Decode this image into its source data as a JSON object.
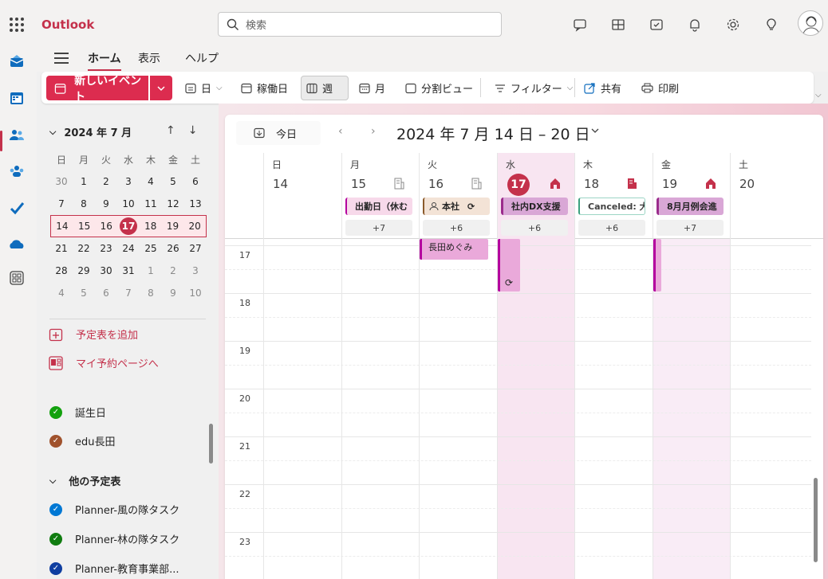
{
  "app": {
    "brand": "Outlook",
    "search_placeholder": "検索",
    "accent": "#c4314b"
  },
  "tabs": [
    {
      "label": "ホーム",
      "active": true
    },
    {
      "label": "表示",
      "active": false
    },
    {
      "label": "ヘルプ",
      "active": false
    }
  ],
  "ribbon": {
    "new_event": "新しいイベント",
    "day": "日",
    "workweek": "稼働日",
    "week": "週",
    "month": "月",
    "split": "分割ビュー",
    "filter": "フィルター",
    "share": "共有",
    "print": "印刷"
  },
  "mini_calendar": {
    "title": "2024 年 7 月",
    "weekdays": [
      "日",
      "月",
      "火",
      "水",
      "木",
      "金",
      "土"
    ],
    "weeks": [
      [
        "30",
        "1",
        "2",
        "3",
        "4",
        "5",
        "6"
      ],
      [
        "7",
        "8",
        "9",
        "10",
        "11",
        "12",
        "13"
      ],
      [
        "14",
        "15",
        "16",
        "17",
        "18",
        "19",
        "20"
      ],
      [
        "21",
        "22",
        "23",
        "24",
        "25",
        "26",
        "27"
      ],
      [
        "28",
        "29",
        "30",
        "31",
        "1",
        "2",
        "3"
      ],
      [
        "4",
        "5",
        "6",
        "7",
        "8",
        "9",
        "10"
      ]
    ],
    "today": "17"
  },
  "sidebar": {
    "add_calendar": "予定表を追加",
    "booking": "マイ予約ページへ",
    "calendars": [
      {
        "name": "誕生日",
        "color": "#13a10e"
      },
      {
        "name": "edu長田",
        "color": "#a0522d"
      }
    ],
    "other_group": "他の予定表",
    "other_calendars": [
      {
        "name": "Planner-風の隊タスク",
        "color": "#0078d4"
      },
      {
        "name": "Planner-林の隊タスク",
        "color": "#107c10"
      },
      {
        "name": "Planner-教育事業部...",
        "color": "#0f3ea0"
      }
    ]
  },
  "calendar": {
    "today_label": "今日",
    "range_title": "2024 年 7 月 14 日 – 20 日",
    "days": [
      {
        "name": "日",
        "num": "14",
        "today": false,
        "event": "",
        "more": ""
      },
      {
        "name": "月",
        "num": "15",
        "today": false,
        "event": "出勤日（休む",
        "more": "+7"
      },
      {
        "name": "火",
        "num": "16",
        "today": false,
        "event": "本社",
        "more": "+6"
      },
      {
        "name": "水",
        "num": "17",
        "today": true,
        "event": "社内DX支援",
        "more": "+6"
      },
      {
        "name": "木",
        "num": "18",
        "today": false,
        "event": "Canceled: 大",
        "more": "+6"
      },
      {
        "name": "金",
        "num": "19",
        "today": false,
        "event": "8月月例会進",
        "more": "+7"
      },
      {
        "name": "土",
        "num": "20",
        "today": false,
        "event": "",
        "more": ""
      }
    ],
    "hours": [
      "17",
      "18",
      "19",
      "20",
      "21",
      "22",
      "23"
    ],
    "grid_event": "長田めぐみ"
  }
}
